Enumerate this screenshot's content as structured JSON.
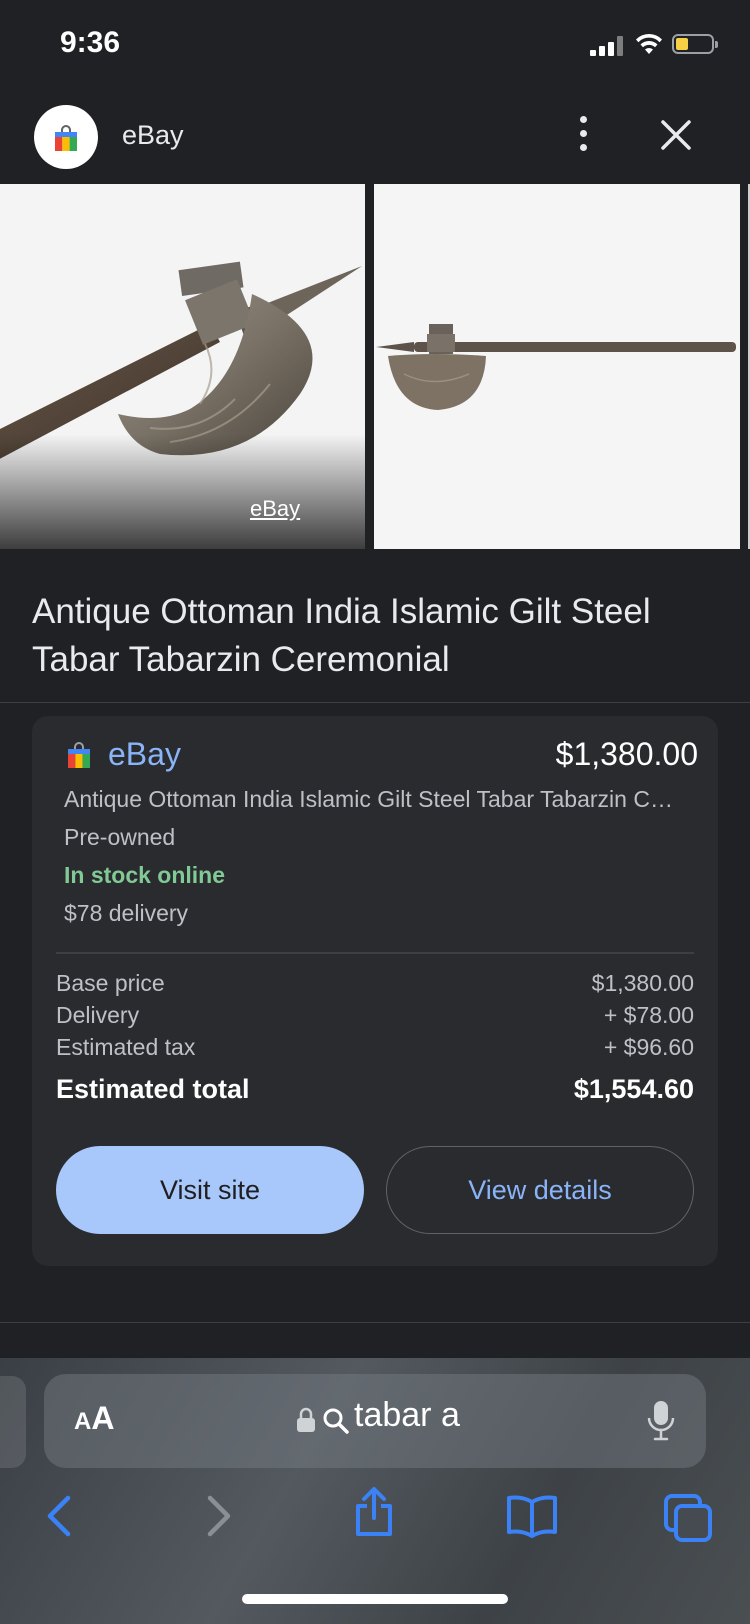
{
  "status_bar": {
    "time": "9:36"
  },
  "header": {
    "site_name": "eBay"
  },
  "images": {
    "first_credit": "eBay"
  },
  "product": {
    "title": "Antique Ottoman India Islamic Gilt Steel Tabar Tabarzin Ceremonial"
  },
  "offer": {
    "merchant": "eBay",
    "price": "$1,380.00",
    "listing_title": "Antique Ottoman India Islamic Gilt Steel Tabar Tabarzin Ceremonial",
    "condition": "Pre-owned",
    "stock": "In stock online",
    "delivery_note": "$78 delivery",
    "breakdown": [
      {
        "label": "Base price",
        "value": "$1,380.00"
      },
      {
        "label": "Delivery",
        "value": "+ $78.00"
      },
      {
        "label": "Estimated tax",
        "value": "+ $96.60"
      }
    ],
    "total": {
      "label": "Estimated total",
      "value": "$1,554.60"
    },
    "visit_label": "Visit site",
    "details_label": "View details"
  },
  "toolbar": {
    "aa_small": "A",
    "aa_big": "A",
    "query": "tabar a"
  },
  "colors": {
    "background": "#202124",
    "link_blue": "#8ab4f8",
    "in_stock_green": "#81c995",
    "primary_button": "#a8c7fa",
    "ios_blue": "#3b82f6"
  },
  "icons": [
    "signal-icon",
    "wifi-icon",
    "battery-icon",
    "shopping-bag-icon",
    "more-vert-icon",
    "close-icon",
    "lock-icon",
    "search-icon",
    "mic-icon",
    "back-icon",
    "forward-icon",
    "share-icon",
    "bookmarks-icon",
    "tabs-icon"
  ]
}
